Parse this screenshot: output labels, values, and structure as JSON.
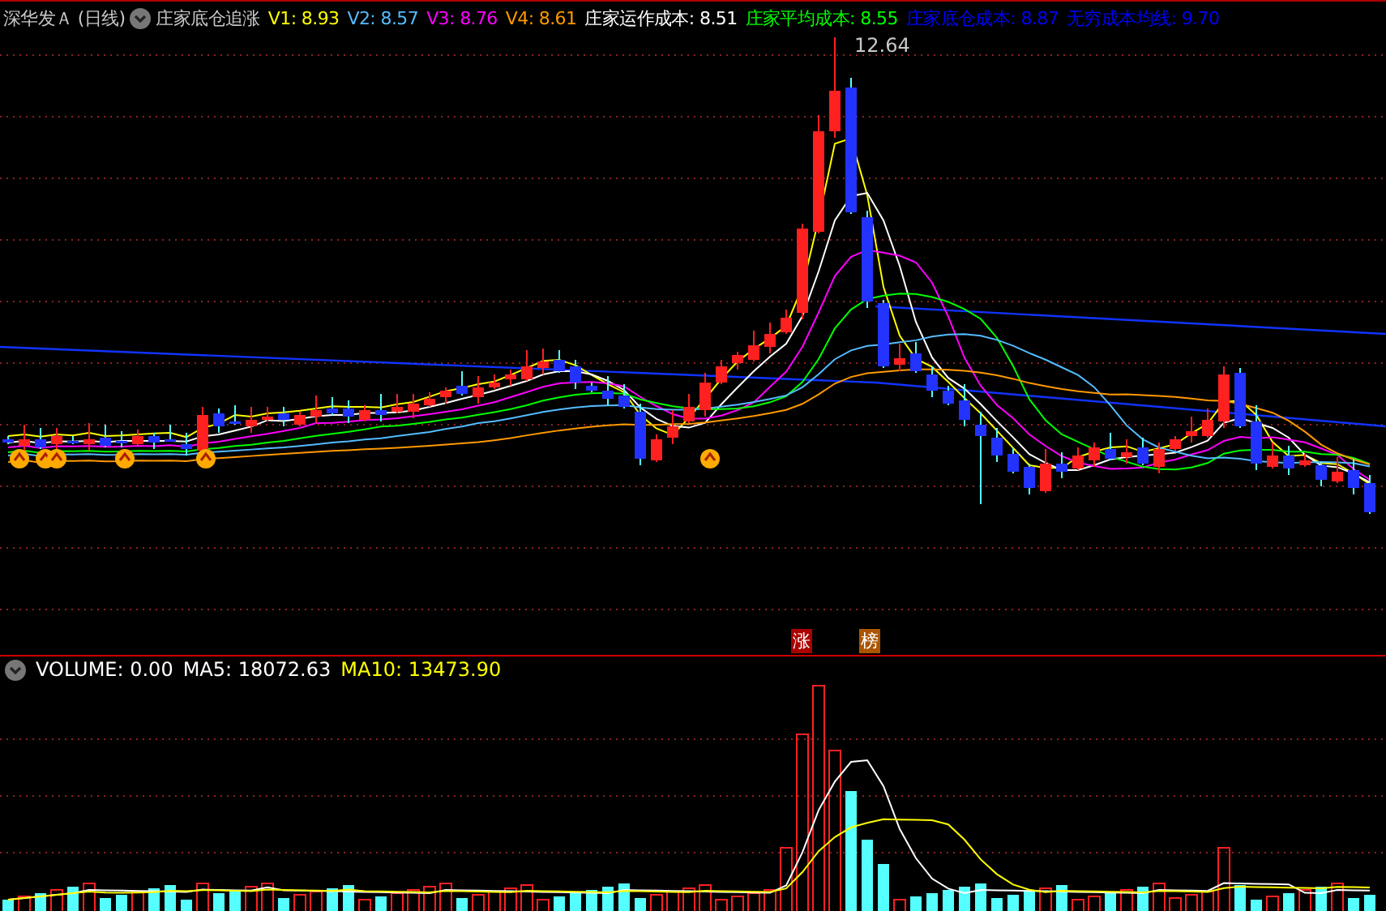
{
  "header": {
    "stock": "深华发Ａ",
    "period": "(日线)",
    "indicator": "庄家底仓追涨"
  },
  "legend": [
    {
      "label": "V1: 8.93",
      "color": "#ffff00"
    },
    {
      "label": "V2: 8.57",
      "color": "#55bbff"
    },
    {
      "label": "V3: 8.76",
      "color": "#ff00ff"
    },
    {
      "label": "V4: 8.61",
      "color": "#ff9900"
    },
    {
      "label": "庄家运作成本: 8.51",
      "color": "#ffffff"
    },
    {
      "label": "庄家平均成本: 8.55",
      "color": "#00ff00"
    },
    {
      "label": "庄家底仓成本: 8.87",
      "color": "#0000ff"
    },
    {
      "label": "无穷成本均线: 9.70",
      "color": "#0000ff"
    }
  ],
  "peak_label": "12.64",
  "tags": [
    {
      "label": "涨",
      "color": "#aa0000"
    },
    {
      "label": "榜",
      "color": "#aa5500"
    }
  ],
  "volume": {
    "legend": [
      {
        "label": "VOLUME: 0.00",
        "color": "#ffffff"
      },
      {
        "label": "MA5: 18072.63",
        "color": "#ffffff"
      },
      {
        "label": "MA10: 13473.90",
        "color": "#ffff00"
      }
    ]
  }
}
